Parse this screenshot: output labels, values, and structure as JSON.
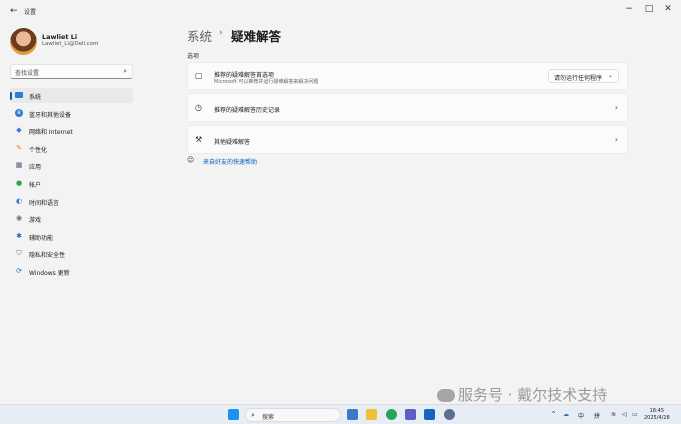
{
  "window": {
    "title": "设置",
    "controls": {
      "minimize": "−",
      "maximize": "□",
      "close": "✕"
    }
  },
  "user": {
    "name": "Lawliet Li",
    "email": "Lawliet_Li@Dell.com"
  },
  "search": {
    "placeholder": "查找设置"
  },
  "sidebar": {
    "items": [
      {
        "label": "系统",
        "icon": "monitor-icon",
        "active": true
      },
      {
        "label": "蓝牙和其他设备",
        "icon": "bluetooth-icon"
      },
      {
        "label": "网络和 Internet",
        "icon": "wifi-icon"
      },
      {
        "label": "个性化",
        "icon": "brush-icon"
      },
      {
        "label": "应用",
        "icon": "apps-icon"
      },
      {
        "label": "帐户",
        "icon": "person-icon"
      },
      {
        "label": "时间和语言",
        "icon": "globe-clock-icon"
      },
      {
        "label": "游戏",
        "icon": "gamepad-icon"
      },
      {
        "label": "辅助功能",
        "icon": "accessibility-icon"
      },
      {
        "label": "隐私和安全性",
        "icon": "shield-icon"
      },
      {
        "label": "Windows 更新",
        "icon": "update-icon"
      }
    ]
  },
  "breadcrumb": {
    "parent": "系统",
    "separator": "›",
    "current": "疑难解答"
  },
  "section_label": "选项",
  "cards": [
    {
      "title": "推荐的疑难解答首选项",
      "desc": "Microsoft 可以推荐并运行疑难解答来解决问题",
      "icon": "chat-bubble-icon",
      "dropdown": "请勿运行任何程序"
    },
    {
      "title": "推荐的疑难解答历史记录",
      "icon": "history-icon"
    },
    {
      "title": "其他疑难解答",
      "icon": "wrench-icon"
    }
  ],
  "help_link": "来自好友的快速帮助",
  "watermark": "服务号 · 戴尔技术支持",
  "taskbar": {
    "search_label": "搜索",
    "tray": {
      "lang": "中",
      "ime": "拼"
    },
    "time": "18:45",
    "date": "2025/4/28"
  },
  "colors": {
    "accent": "#005fb8",
    "background": "#f3f3f3",
    "card": "#fbfbfb"
  }
}
